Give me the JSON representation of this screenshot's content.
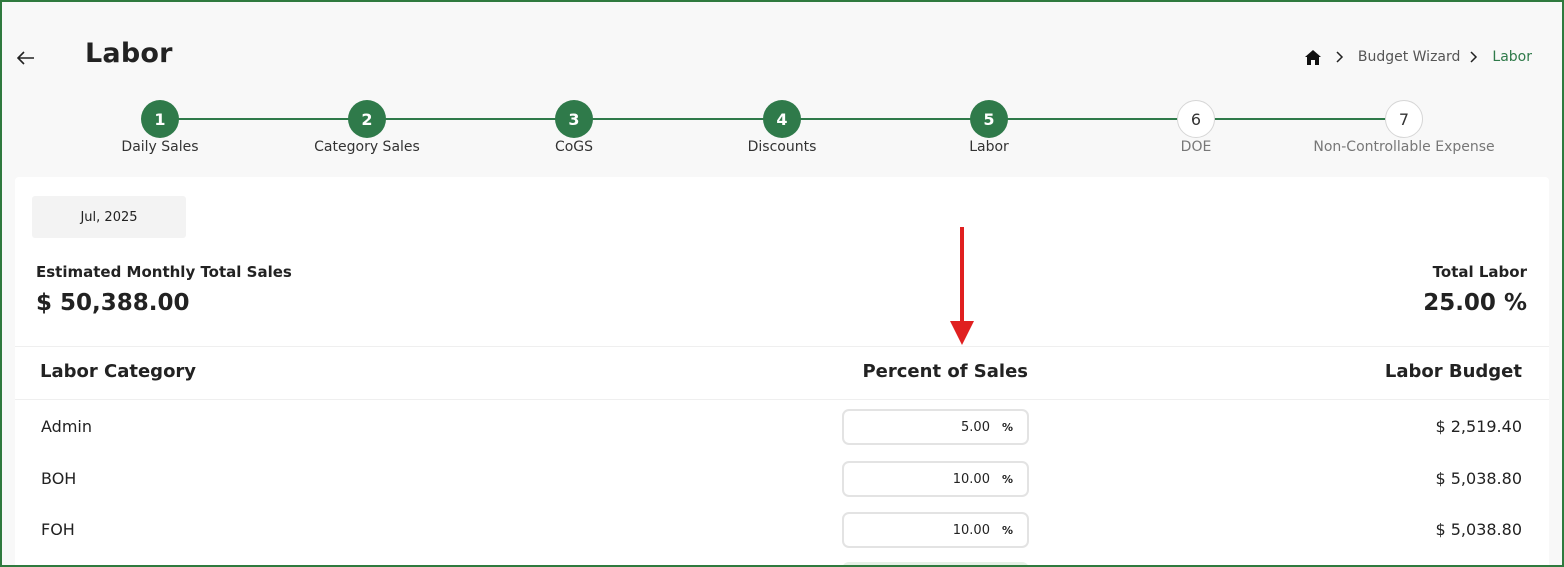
{
  "header": {
    "title": "Labor",
    "breadcrumb": {
      "parent": "Budget Wizard",
      "current": "Labor"
    }
  },
  "stepper": {
    "steps": [
      {
        "number": "1",
        "label": "Daily Sales",
        "state": "done"
      },
      {
        "number": "2",
        "label": "Category Sales",
        "state": "done"
      },
      {
        "number": "3",
        "label": "CoGS",
        "state": "done"
      },
      {
        "number": "4",
        "label": "Discounts",
        "state": "done"
      },
      {
        "number": "5",
        "label": "Labor",
        "state": "done"
      },
      {
        "number": "6",
        "label": "DOE",
        "state": "todo"
      },
      {
        "number": "7",
        "label": "Non-Controllable Expense",
        "state": "todo"
      }
    ]
  },
  "summary": {
    "month": "Jul, 2025",
    "estimated_sales_label": "Estimated Monthly Total Sales",
    "estimated_sales_value": "$ 50,388.00",
    "total_labor_label": "Total Labor",
    "total_labor_value": "25.00 %"
  },
  "table": {
    "headers": {
      "category": "Labor Category",
      "percent": "Percent of Sales",
      "budget": "Labor Budget"
    },
    "percent_unit": "%",
    "rows": [
      {
        "category": "Admin",
        "percent": "5.00",
        "budget": "$ 2,519.40"
      },
      {
        "category": "BOH",
        "percent": "10.00",
        "budget": "$ 5,038.80"
      },
      {
        "category": "FOH",
        "percent": "10.00",
        "budget": "$ 5,038.80"
      }
    ]
  },
  "colors": {
    "accent": "#2f7a4a",
    "frame": "#2f7a3e",
    "annotation_arrow": "#e02020"
  },
  "icons": {
    "back": "arrow-left-icon",
    "home": "home-icon",
    "separator": "chevron-right-icon"
  }
}
